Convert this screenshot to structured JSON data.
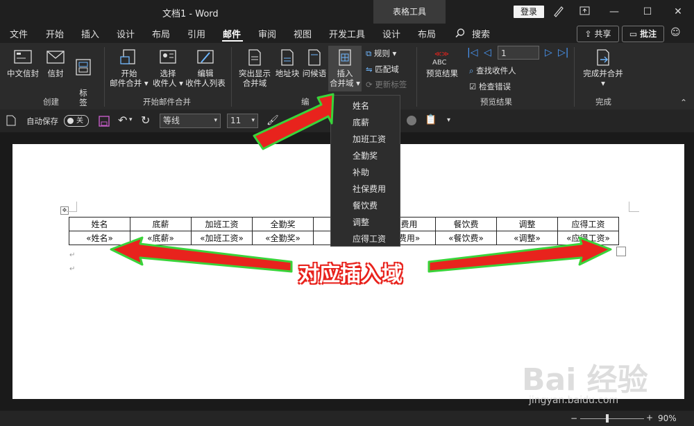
{
  "window": {
    "doc_title": "文档1  -  Word",
    "context_tab": "表格工具",
    "login_label": "登录"
  },
  "tabs": [
    "文件",
    "开始",
    "插入",
    "设计",
    "布局",
    "引用",
    "邮件",
    "审阅",
    "视图",
    "开发工具",
    "设计",
    "布局"
  ],
  "search_label": "搜索",
  "share_label": "共享",
  "comment_label": "批注",
  "ribbon": {
    "create": {
      "chinese_envelope": "中文信封",
      "envelope": "信封",
      "labels": "标\n签",
      "group": "创建"
    },
    "start_merge": {
      "start": "开始",
      "start_sub": "邮件合并",
      "select": "选择",
      "select_sub": "收件人",
      "edit": "编辑",
      "edit_sub": "收件人列表",
      "group": "开始邮件合并"
    },
    "write_insert": {
      "highlight": "突出显示",
      "highlight_sub": "合并域",
      "address": "地址块",
      "greeting": "问候语",
      "insert": "插入",
      "insert_sub": "合并域",
      "rules": "规则",
      "match": "匹配域",
      "update": "更新标签",
      "group": "编"
    },
    "preview": {
      "preview_results": "预览结果",
      "record_value": "1",
      "find_recipient": "查找收件人",
      "check_errors": "检查错误",
      "group": "预览结果"
    },
    "finish": {
      "finish_merge": "完成并合并",
      "group": "完成"
    }
  },
  "qat": {
    "autosave": "自动保存",
    "toggle_state": "关",
    "font": "等线",
    "font_size": "11"
  },
  "table": {
    "headers": [
      "姓名",
      "底薪",
      "加班工资",
      "全勤奖",
      "",
      "保费用",
      "餐饮费",
      "调整",
      "应得工资"
    ],
    "fields": [
      "«姓名»",
      "«底薪»",
      "«加班工资»",
      "«全勤奖»",
      "",
      "保费用»",
      "«餐饮费»",
      "«调整»",
      "«应得工资»"
    ]
  },
  "dropdown_items": [
    "姓名",
    "底薪",
    "加班工资",
    "全勤奖",
    "补助",
    "社保费用",
    "餐饮费",
    "调整",
    "应得工资"
  ],
  "annotation": "对应插入域",
  "status": {
    "zoom": "90%"
  },
  "watermark": {
    "logo": "Bai 经验",
    "url": "jingyan.baidu.com"
  },
  "colors": {
    "arrow_fill": "#e8231d",
    "arrow_outline": "#39d43a",
    "page": "#ffffff",
    "ribbon": "#2b2b2b"
  }
}
